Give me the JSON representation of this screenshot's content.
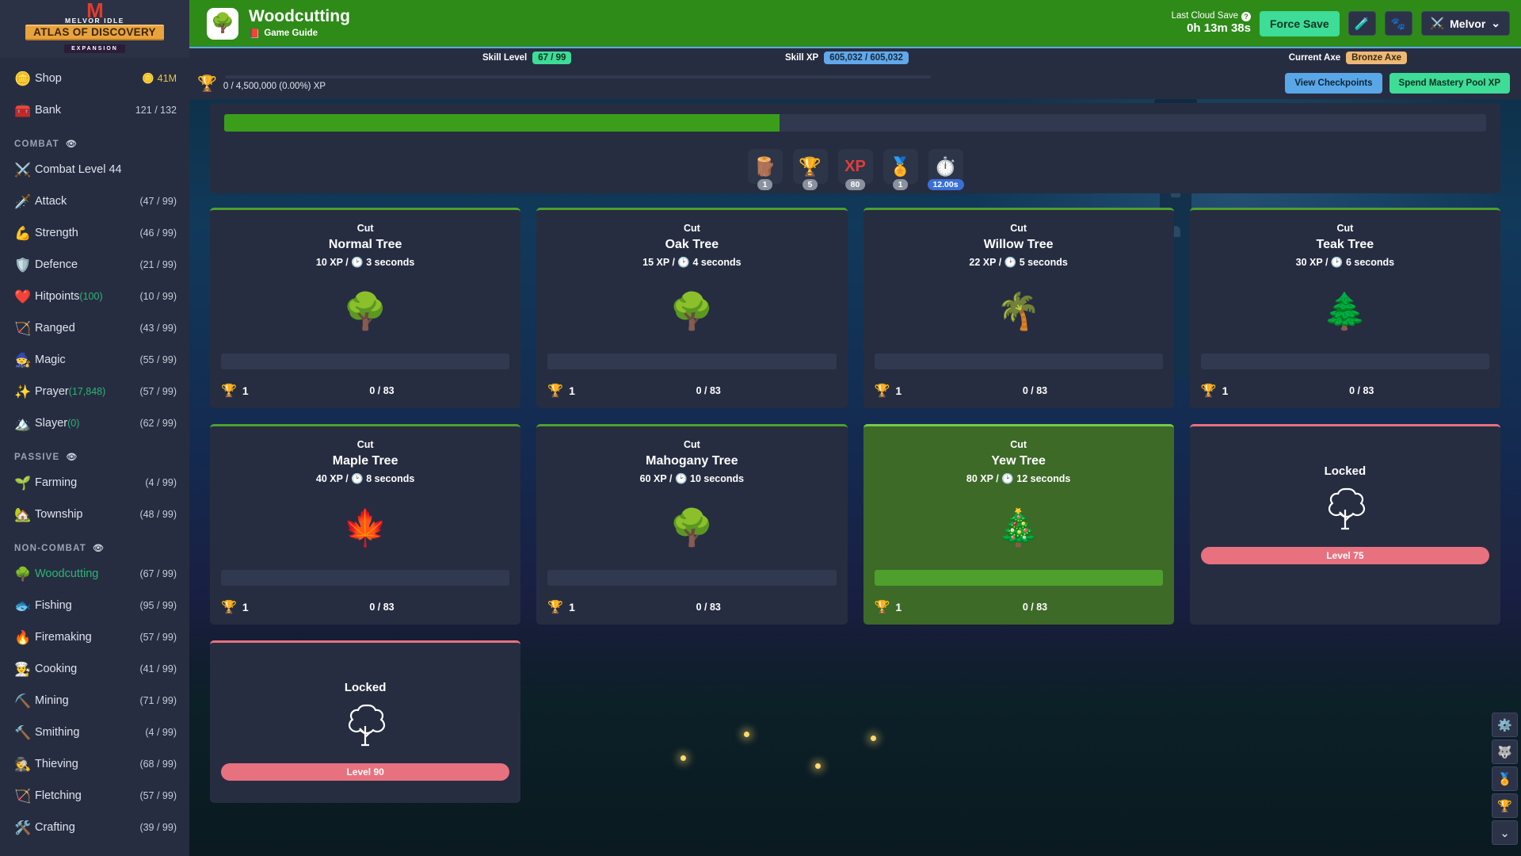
{
  "sidebar": {
    "logo": {
      "m": "M",
      "brand": "MELVOR IDLE",
      "title": "ATLAS OF DISCOVERY",
      "expansion": "EXPANSION"
    },
    "top_items": [
      {
        "icon": "coin-icon",
        "glyph": "🪙",
        "label": "Shop",
        "right": "41M",
        "right_icon": "🪙",
        "right_gold": true
      },
      {
        "icon": "bank-icon",
        "glyph": "🧰",
        "label": "Bank",
        "right": "121 / 132",
        "right_gold": false
      }
    ],
    "sections": [
      {
        "title": "COMBAT",
        "items": [
          {
            "icon": "swords-icon",
            "glyph": "⚔️",
            "label": "Combat Level 44",
            "right": ""
          },
          {
            "icon": "sword-icon",
            "glyph": "🗡️",
            "label": "Attack",
            "right": "(47 / 99)"
          },
          {
            "icon": "biceps-icon",
            "glyph": "💪",
            "label": "Strength",
            "right": "(46 / 99)"
          },
          {
            "icon": "shield-icon",
            "glyph": "🛡️",
            "label": "Defence",
            "right": "(21 / 99)"
          },
          {
            "icon": "heart-icon",
            "glyph": "❤️",
            "label": "Hitpoints",
            "sub": "(100)",
            "right": "(10 / 99)"
          },
          {
            "icon": "bow-icon",
            "glyph": "🏹",
            "label": "Ranged",
            "right": "(43 / 99)"
          },
          {
            "icon": "wizard-hat-icon",
            "glyph": "🧙",
            "label": "Magic",
            "right": "(55 / 99)"
          },
          {
            "icon": "sparkles-icon",
            "glyph": "✨",
            "label": "Prayer",
            "sub": "(17,848)",
            "right": "(57 / 99)"
          },
          {
            "icon": "slayer-icon",
            "glyph": "🏔️",
            "label": "Slayer",
            "sub": "(0)",
            "right": "(62 / 99)"
          }
        ]
      },
      {
        "title": "PASSIVE",
        "items": [
          {
            "icon": "seedling-icon",
            "glyph": "🌱",
            "label": "Farming",
            "right": "(4 / 99)"
          },
          {
            "icon": "township-icon",
            "glyph": "🏡",
            "label": "Township",
            "right": "(48 / 99)"
          }
        ]
      },
      {
        "title": "NON-COMBAT",
        "items": [
          {
            "icon": "tree-icon",
            "glyph": "🌳",
            "label": "Woodcutting",
            "right": "(67 / 99)",
            "active": true
          },
          {
            "icon": "fish-icon",
            "glyph": "🐟",
            "label": "Fishing",
            "right": "(95 / 99)"
          },
          {
            "icon": "campfire-icon",
            "glyph": "🔥",
            "label": "Firemaking",
            "right": "(57 / 99)"
          },
          {
            "icon": "chef-hat-icon",
            "glyph": "👨‍🍳",
            "label": "Cooking",
            "right": "(41 / 99)"
          },
          {
            "icon": "pickaxe-icon",
            "glyph": "⛏️",
            "label": "Mining",
            "right": "(71 / 99)"
          },
          {
            "icon": "anvil-icon",
            "glyph": "🔨",
            "label": "Smithing",
            "right": "(4 / 99)"
          },
          {
            "icon": "thief-icon",
            "glyph": "🕵️",
            "label": "Thieving",
            "right": "(68 / 99)"
          },
          {
            "icon": "arrow-icon",
            "glyph": "🏹",
            "label": "Fletching",
            "right": "(57 / 99)"
          },
          {
            "icon": "crafting-icon",
            "glyph": "🛠️",
            "label": "Crafting",
            "right": "(39 / 99)"
          }
        ]
      }
    ]
  },
  "header": {
    "skill_icon": "tree-icon",
    "skill_glyph": "🌳",
    "title": "Woodcutting",
    "guide_label": "Game Guide",
    "guide_glyph": "📕",
    "cloud_save_label": "Last Cloud Save",
    "cloud_save_value": "0h 13m 38s",
    "force_save_label": "Force Save",
    "potion_glyph": "🧪",
    "pets_glyph": "🐾",
    "user_name": "Melvor",
    "user_glyph": "⚔️",
    "chevron": "⌄",
    "accent": "#2e8b18"
  },
  "statusbar": {
    "skill_level_label": "Skill Level",
    "skill_level_value": "67 / 99",
    "skill_xp_label": "Skill XP",
    "skill_xp_value": "605,032 / 605,032",
    "current_axe_label": "Current Axe",
    "current_axe_value": "Bronze Axe"
  },
  "mastery_pool": {
    "glyph": "🏆",
    "text": "0 / 4,500,000 (0.00%) XP",
    "view_checkpoints_label": "View Checkpoints",
    "spend_label": "Spend Mastery Pool XP"
  },
  "progress_panel": {
    "progress_percent": 44,
    "badges": [
      {
        "name": "logs-badge",
        "glyph": "🪵",
        "count": "1",
        "highlight": false
      },
      {
        "name": "mastery-trophy-badge",
        "glyph": "🏆",
        "count": "5",
        "highlight": false
      },
      {
        "name": "xp-badge",
        "text": "XP",
        "count": "80",
        "highlight": false
      },
      {
        "name": "mastery-xp-badge",
        "glyph": "🏅",
        "count": "1",
        "highlight": false
      },
      {
        "name": "interval-badge",
        "glyph": "⏱️",
        "count": "12.00s",
        "highlight": true
      }
    ]
  },
  "trees": [
    {
      "action": "Cut",
      "name": "Normal Tree",
      "xp": "10 XP",
      "time": "3 seconds",
      "glyph": "🌳",
      "mastery_level": "1",
      "mastery_count": "0 / 83",
      "progress": 0,
      "mastery_progress": 0,
      "state": "idle"
    },
    {
      "action": "Cut",
      "name": "Oak Tree",
      "xp": "15 XP",
      "time": "4 seconds",
      "glyph": "🌳",
      "mastery_level": "1",
      "mastery_count": "0 / 83",
      "progress": 0,
      "mastery_progress": 0,
      "state": "idle"
    },
    {
      "action": "Cut",
      "name": "Willow Tree",
      "xp": "22 XP",
      "time": "5 seconds",
      "glyph": "🌴",
      "mastery_level": "1",
      "mastery_count": "0 / 83",
      "progress": 0,
      "mastery_progress": 0,
      "state": "idle"
    },
    {
      "action": "Cut",
      "name": "Teak Tree",
      "xp": "30 XP",
      "time": "6 seconds",
      "glyph": "🌲",
      "mastery_level": "1",
      "mastery_count": "0 / 83",
      "progress": 0,
      "mastery_progress": 0,
      "state": "idle"
    },
    {
      "action": "Cut",
      "name": "Maple Tree",
      "xp": "40 XP",
      "time": "8 seconds",
      "glyph": "🍁",
      "mastery_level": "1",
      "mastery_count": "0 / 83",
      "progress": 0,
      "mastery_progress": 0,
      "state": "idle"
    },
    {
      "action": "Cut",
      "name": "Mahogany Tree",
      "xp": "60 XP",
      "time": "10 seconds",
      "glyph": "🌳",
      "mastery_level": "1",
      "mastery_count": "0 / 83",
      "progress": 0,
      "mastery_progress": 0,
      "state": "idle"
    },
    {
      "action": "Cut",
      "name": "Yew Tree",
      "xp": "80 XP",
      "time": "12 seconds",
      "glyph": "🎄",
      "mastery_level": "1",
      "mastery_count": "0 / 83",
      "progress": 100,
      "mastery_progress": 0,
      "state": "active"
    },
    {
      "locked_label": "Locked",
      "requirement": "Level 75",
      "state": "locked"
    },
    {
      "locked_label": "Locked",
      "requirement": "Level 90",
      "state": "locked"
    }
  ],
  "rail": [
    {
      "name": "settings-gear-icon",
      "glyph": "⚙️"
    },
    {
      "name": "wolf-pet-icon",
      "glyph": "🐺"
    },
    {
      "name": "medal-icon",
      "glyph": "🏅"
    },
    {
      "name": "trophy-icon",
      "glyph": "🏆"
    },
    {
      "name": "chevron-down-icon",
      "glyph": "⌄"
    }
  ],
  "labels": {
    "xp_separator": "/",
    "clock_glyph": "🕑",
    "trophy_glyph": "🏆"
  }
}
